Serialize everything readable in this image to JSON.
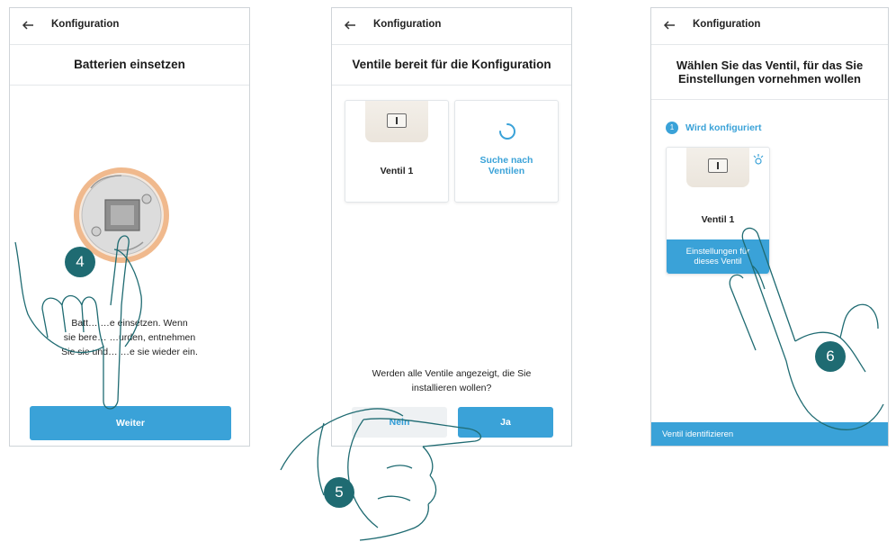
{
  "colors": {
    "accent": "#3aa2d8",
    "step_number": "#1f6b72",
    "hand_outline": "#1f6b72"
  },
  "screens": [
    {
      "topbar_title": "Konfiguration",
      "heading": "Batterien einsetzen",
      "body_lines": [
        "Batt… …e einsetzen. Wenn",
        "sie bere… …urden, entnehmen",
        "Sie sie und… …e sie wieder ein."
      ],
      "primary_button": "Weiter"
    },
    {
      "topbar_title": "Konfiguration",
      "heading": "Ventile bereit für die Konfiguration",
      "valve_card_label": "Ventil 1",
      "search_card_label_line1": "Suche nach",
      "search_card_label_line2": "Ventilen",
      "question_line1": "Werden alle Ventile angezeigt, die Sie",
      "question_line2": "installieren wollen?",
      "no_button": "Nein",
      "yes_button": "Ja"
    },
    {
      "topbar_title": "Konfiguration",
      "heading_line1": "Wählen Sie das Ventil, für das Sie",
      "heading_line2": "Einstellungen vornehmen wollen",
      "step_number": "1",
      "step_label": "Wird konfiguriert",
      "valve_card_label": "Ventil 1",
      "settings_button_line1": "Einstellungen für",
      "settings_button_line2": "dieses Ventil",
      "bottom_action": "Ventil identifizieren"
    }
  ],
  "step_markers": [
    "4",
    "5",
    "6"
  ],
  "icons": [
    "back-arrow-icon",
    "loading-spinner-icon",
    "blink-indicator-icon",
    "pointing-hand-icon"
  ]
}
